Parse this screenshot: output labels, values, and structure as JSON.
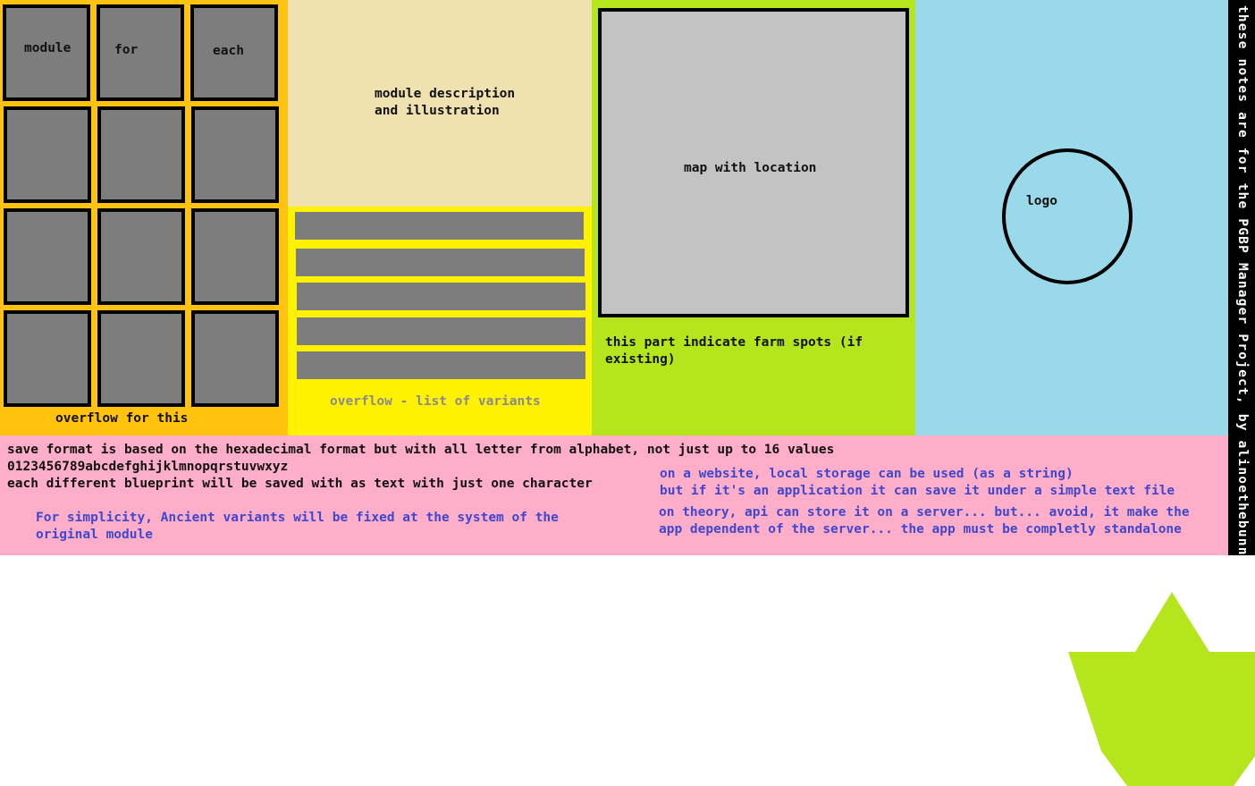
{
  "module_grid": {
    "tile_labels": [
      "module",
      "for",
      "each"
    ],
    "overflow_note": "overflow for this"
  },
  "description": {
    "line1": "module description",
    "line2": "and illustration"
  },
  "variants": {
    "overflow_note": "overflow - list of variants",
    "bar_count": 5
  },
  "map": {
    "label": "map with location",
    "note_line1": "this part indicate farm spots (if",
    "note_line2": "existing)"
  },
  "logo": {
    "label": "logo"
  },
  "side_note": "these notes are for the PGBP Manager Project, by alinoethebunny",
  "save_format": {
    "line1": "save format is based on the hexadecimal format but with all letter from alphabet, not just up to 16 values",
    "line2": "0123456789abcdefghijklmnopqrstuvwxyz",
    "line3": "each different blueprint will be saved with as text with just one character"
  },
  "ancient_note": {
    "line1": "For simplicity, Ancient variants will be fixed at the system of the",
    "line2": "original module"
  },
  "storage_note": {
    "line1": "on a website, local storage can be used (as a string)",
    "line2": "but if it's an application it can save it under a simple text file",
    "line3": "on theory, api can store it on a server... but... avoid, it make the",
    "line4": "app dependent of the server... the app must be completly standalone"
  },
  "colors": {
    "orange": "#ffc20e",
    "cream": "#efe2b0",
    "yellow": "#fff200",
    "lime": "#b5e61d",
    "light_blue": "#99d9ea",
    "pink": "#ffaec9",
    "gray": "#7d7d7d",
    "note_blue": "#3f48cc"
  }
}
